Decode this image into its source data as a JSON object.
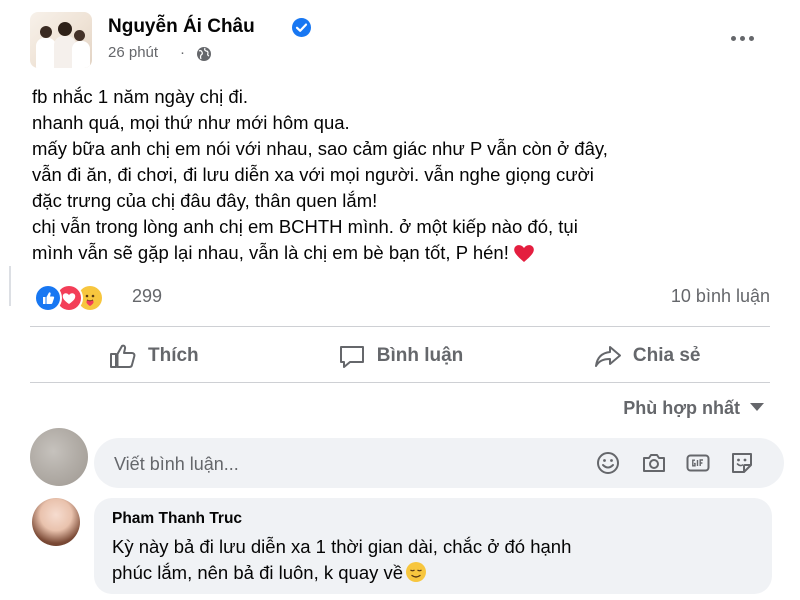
{
  "post": {
    "author_name": "Nguyễn Ái Châu",
    "time": "26 phút",
    "separator": "·",
    "text_lines": [
      "fb nhắc 1 năm ngày chị đi.",
      "nhanh quá, mọi thứ như mới hôm qua.",
      "mấy bữa anh chị em nói với nhau, sao cảm giác như P vẫn còn ở đây,",
      "vẫn đi ăn, đi chơi, đi lưu diễn xa với mọi người. vẫn nghe giọng cười",
      "đặc trưng của chị đâu đây, thân quen lắm!",
      "chị vẫn trong lòng anh chị em BCHTH mình. ở một kiếp nào đó, tụi",
      "mình vẫn sẽ gặp lại nhau, vẫn là chị em bè bạn tốt, P hén!"
    ],
    "reaction_count": "299",
    "comment_count": "10 bình luận"
  },
  "actions": {
    "like": "Thích",
    "comment": "Bình luận",
    "share": "Chia sẻ"
  },
  "sort": {
    "label": "Phù hợp nhất"
  },
  "comment_box": {
    "placeholder": "Viết bình luận..."
  },
  "comments": [
    {
      "name": "Pham Thanh Truc",
      "text_lines": [
        "Kỳ này bả đi lưu diễn xa 1 thời gian dài, chắc ở đó hạnh",
        "phúc lắm, nên bả đi luôn, k quay về"
      ]
    }
  ],
  "colors": {
    "brand_blue": "#1877f2",
    "love_red": "#f33e58",
    "care_yellow": "#f7c63e",
    "secondary_text": "#65676b",
    "bubble_bg": "#f0f2f5"
  },
  "icons": {
    "verified": "verified-badge-icon",
    "audience": "globe-icon",
    "more": "more-options-icon",
    "like": "thumbs-up-icon",
    "comment": "speech-bubble-icon",
    "share": "share-arrow-icon"
  }
}
